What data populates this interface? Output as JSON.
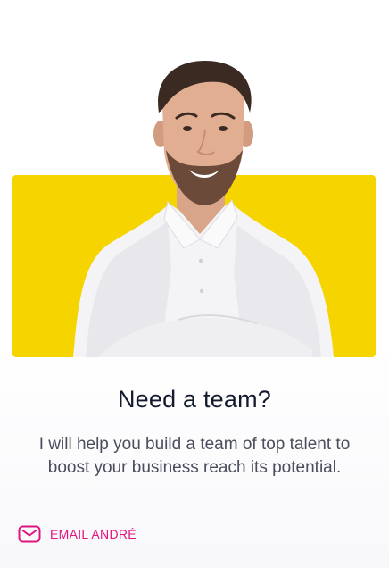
{
  "card": {
    "title": "Need a team?",
    "description": "I will help you build a team of top talent to boost your business reach its potential.",
    "cta_label": "EMAIL ANDRÉ",
    "cta_icon": "mail-icon"
  },
  "colors": {
    "accent_yellow": "#f5d400",
    "title": "#141a2e",
    "body_text": "#4b4d5c",
    "cta": "#e0147f"
  }
}
